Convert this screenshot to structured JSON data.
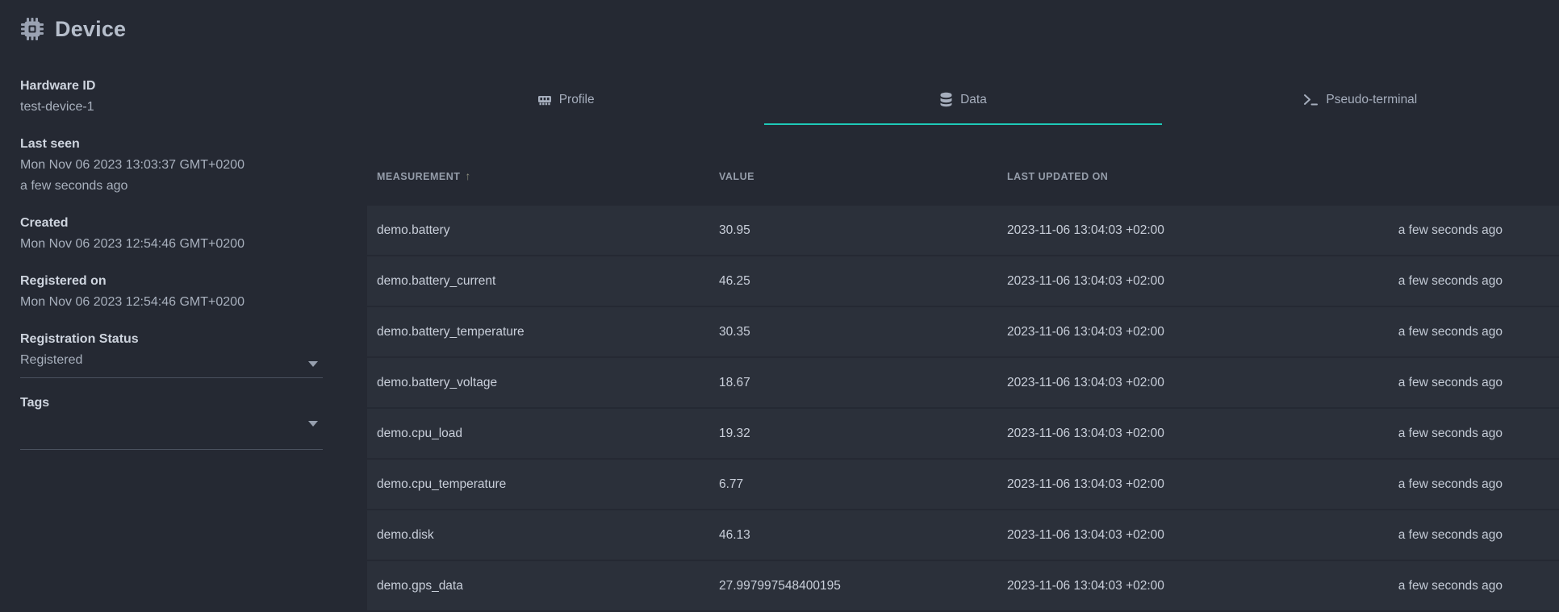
{
  "colors": {
    "accent_teal": "#1ec9b8",
    "page_bg": "#252933",
    "row_bg": "#2b303a"
  },
  "header": {
    "title": "Device",
    "icon": "chip-icon"
  },
  "sidebar": {
    "fields": [
      {
        "label": "Hardware ID",
        "lines": [
          "test-device-1"
        ]
      },
      {
        "label": "Last seen",
        "lines": [
          "Mon Nov 06 2023 13:03:37 GMT+0200",
          "a few seconds ago"
        ]
      },
      {
        "label": "Created",
        "lines": [
          "Mon Nov 06 2023 12:54:46 GMT+0200"
        ]
      },
      {
        "label": "Registered on",
        "lines": [
          "Mon Nov 06 2023 12:54:46 GMT+0200"
        ]
      }
    ],
    "registration_status": {
      "label": "Registration Status",
      "value": "Registered"
    },
    "tags": {
      "label": "Tags",
      "value": ""
    }
  },
  "tabs": {
    "profile": {
      "label": "Profile",
      "icon": "ram-icon",
      "active": false
    },
    "data": {
      "label": "Data",
      "icon": "database-icon",
      "active": true
    },
    "pseudo_terminal": {
      "label": "Pseudo-terminal",
      "icon": "terminal-icon",
      "active": false
    }
  },
  "table": {
    "columns": {
      "measurement": "MEASUREMENT",
      "value": "VALUE",
      "updated": "LAST UPDATED ON",
      "relative": ""
    },
    "sorted_by": "MEASUREMENT",
    "sort_direction": "ascending",
    "sort_arrow": "↑",
    "rows": [
      {
        "measurement": "demo.battery",
        "value": "30.95",
        "updated": "2023-11-06 13:04:03 +02:00",
        "relative": "a few seconds ago"
      },
      {
        "measurement": "demo.battery_current",
        "value": "46.25",
        "updated": "2023-11-06 13:04:03 +02:00",
        "relative": "a few seconds ago"
      },
      {
        "measurement": "demo.battery_temperature",
        "value": "30.35",
        "updated": "2023-11-06 13:04:03 +02:00",
        "relative": "a few seconds ago"
      },
      {
        "measurement": "demo.battery_voltage",
        "value": "18.67",
        "updated": "2023-11-06 13:04:03 +02:00",
        "relative": "a few seconds ago"
      },
      {
        "measurement": "demo.cpu_load",
        "value": "19.32",
        "updated": "2023-11-06 13:04:03 +02:00",
        "relative": "a few seconds ago"
      },
      {
        "measurement": "demo.cpu_temperature",
        "value": "6.77",
        "updated": "2023-11-06 13:04:03 +02:00",
        "relative": "a few seconds ago"
      },
      {
        "measurement": "demo.disk",
        "value": "46.13",
        "updated": "2023-11-06 13:04:03 +02:00",
        "relative": "a few seconds ago"
      },
      {
        "measurement": "demo.gps_data",
        "value": "27.997997548400195",
        "updated": "2023-11-06 13:04:03 +02:00",
        "relative": "a few seconds ago"
      }
    ]
  }
}
